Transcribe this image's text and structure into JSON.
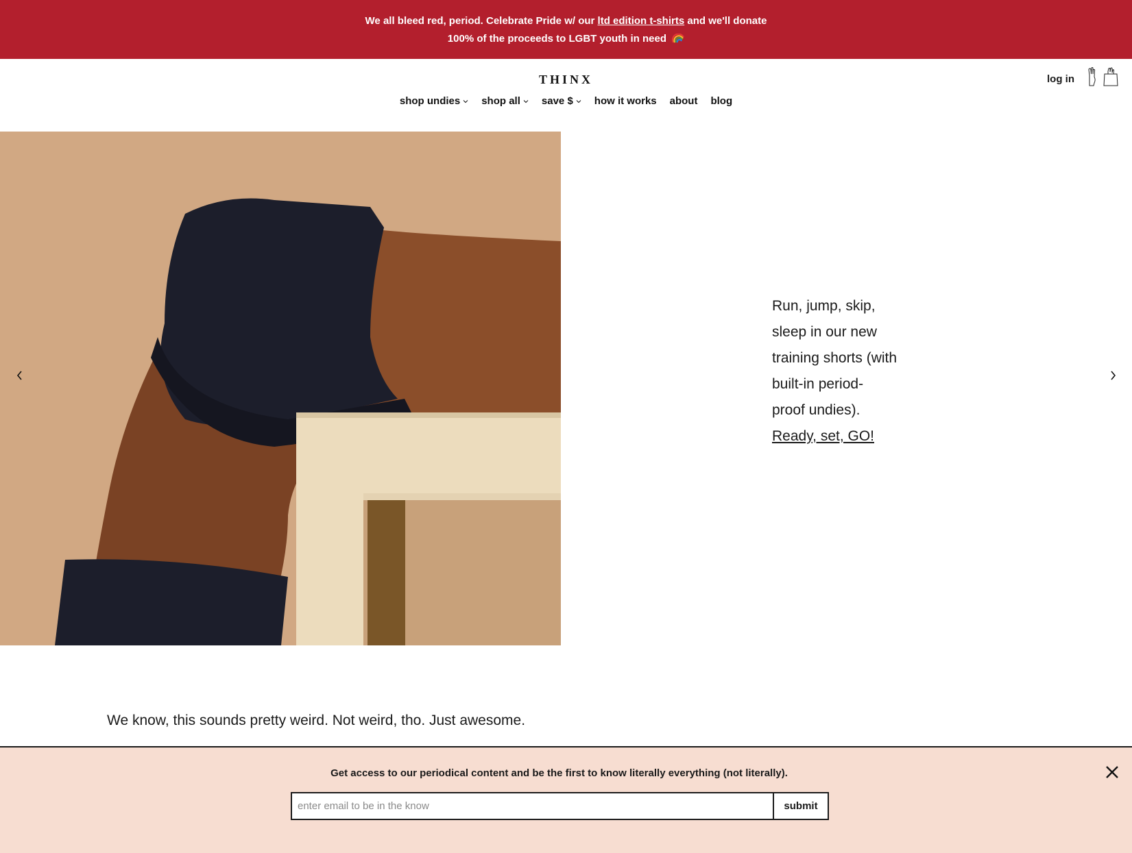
{
  "promo": {
    "line1_pre": "We all bleed red, period. Celebrate Pride w/ our ",
    "line1_link": "ltd edition t-shirts",
    "line1_post": " and we'll donate",
    "line2": "100% of the proceeds to LGBT youth in need",
    "icon": "rainbow-icon"
  },
  "header": {
    "logo": "THINX",
    "login": "log in",
    "icons": [
      "hand-icon",
      "shopping-bag-icon"
    ]
  },
  "nav": {
    "items": [
      {
        "label": "shop undies",
        "dropdown": true
      },
      {
        "label": "shop all",
        "dropdown": true
      },
      {
        "label": "save $",
        "dropdown": true
      },
      {
        "label": "how it works",
        "dropdown": false
      },
      {
        "label": "about",
        "dropdown": false
      },
      {
        "label": "blog",
        "dropdown": false
      }
    ]
  },
  "hero": {
    "lines": [
      "Run, jump, skip,",
      "sleep in our new",
      "training shorts (with",
      "built-in period-",
      "proof undies)."
    ],
    "cta": "Ready, set, GO!",
    "prev_icon": "chevron-left-icon",
    "next_icon": "chevron-right-icon"
  },
  "tagline": "We know, this sounds pretty weird. Not weird, tho. Just awesome.",
  "newsletter": {
    "text": "Get access to our periodical content and be the first to know literally everything (not literally).",
    "placeholder": "enter email to be in the know",
    "submit": "submit",
    "close_icon": "close-icon"
  },
  "colors": {
    "promo_bg": "#b31f2d",
    "hero_bg": "#d1a883",
    "newsletter_bg": "#f7ddd1"
  }
}
